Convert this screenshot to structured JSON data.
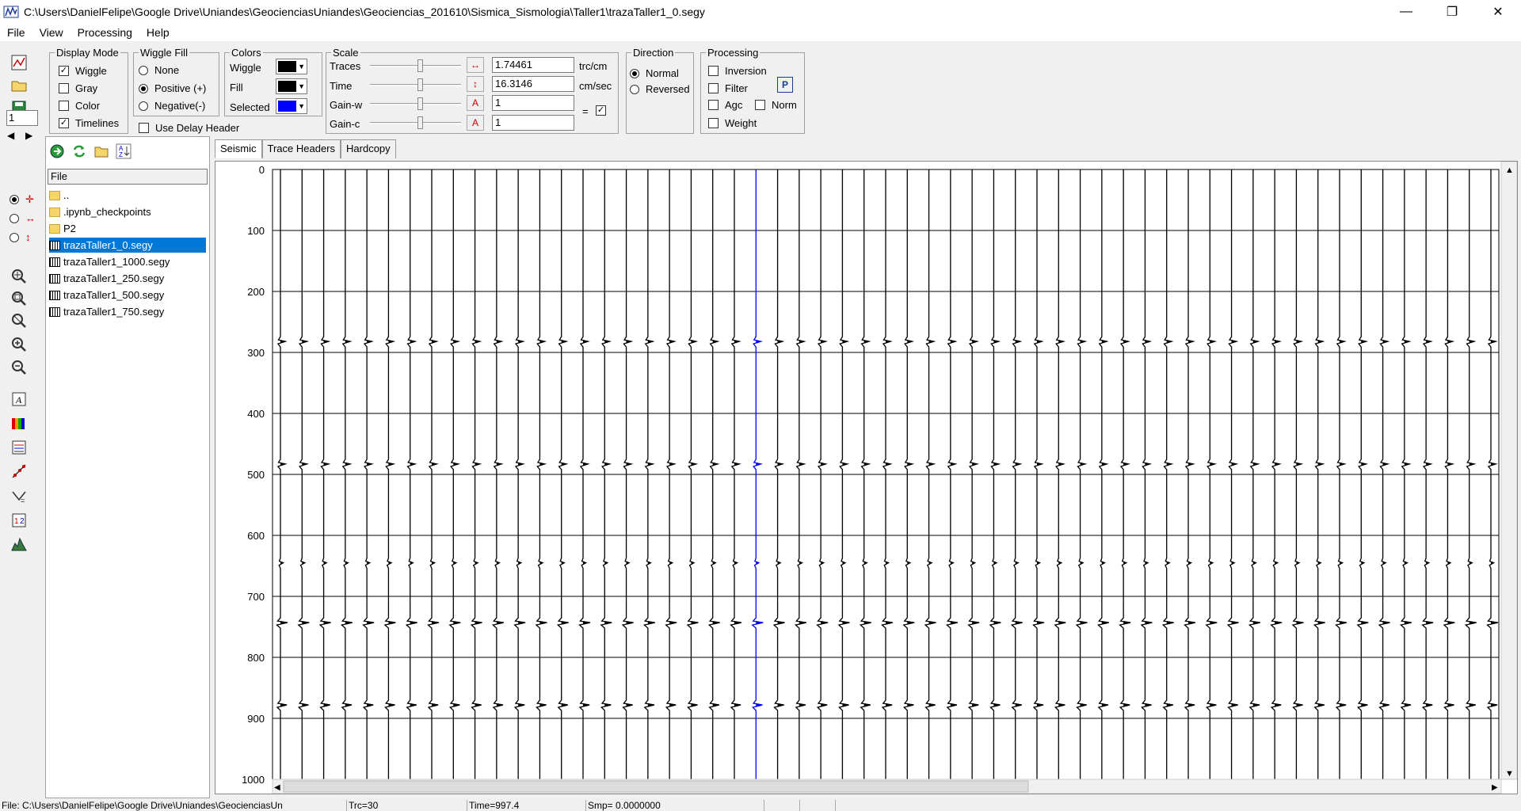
{
  "window": {
    "title": "C:\\Users\\DanielFelipe\\Google Drive\\Uniandes\\GeocienciasUniandes\\Geociencias_201610\\Sismica_Sismologia\\Taller1\\trazaTaller1_0.segy",
    "minimize": "—",
    "maximize": "❐",
    "close": "✕"
  },
  "menu": [
    "File",
    "View",
    "Processing",
    "Help"
  ],
  "display_mode": {
    "legend": "Display Mode",
    "wiggle": "Wiggle",
    "gray": "Gray",
    "color": "Color",
    "timelines": "Timelines",
    "wiggle_checked": true,
    "gray_checked": false,
    "color_checked": false,
    "timelines_checked": true
  },
  "wiggle_fill": {
    "legend": "Wiggle Fill",
    "none": "None",
    "positive": "Positive (+)",
    "negative": "Negative(-)",
    "selected": "positive"
  },
  "use_delay_header": {
    "label": "Use Delay  Header",
    "checked": false
  },
  "colors": {
    "legend": "Colors",
    "wiggle_label": "Wiggle",
    "fill_label": "Fill",
    "selected_label": "Selected",
    "wiggle_color": "#000000",
    "fill_color": "#000000",
    "selected_color": "#0000ff"
  },
  "scale": {
    "legend": "Scale",
    "traces_label": "Traces",
    "time_label": "Time",
    "gainw_label": "Gain-w",
    "gainc_label": "Gain-c",
    "traces_value": "1.74461",
    "time_value": "16.3146",
    "gainw_value": "1",
    "gainc_value": "1",
    "traces_unit": "trc/cm",
    "time_unit": "cm/sec",
    "equals": "=",
    "link_checked": true
  },
  "direction": {
    "legend": "Direction",
    "normal": "Normal",
    "reversed": "Reversed",
    "selected": "normal"
  },
  "processing": {
    "legend": "Processing",
    "inversion": "Inversion",
    "filter": "Filter",
    "agc": "Agc",
    "norm": "Norm",
    "weight": "Weight",
    "p_button": "P"
  },
  "trace_spin": "1",
  "file_panel": {
    "header": "File",
    "items": [
      {
        "name": "..",
        "type": "folder"
      },
      {
        "name": ".ipynb_checkpoints",
        "type": "folder"
      },
      {
        "name": "P2",
        "type": "folder"
      },
      {
        "name": "trazaTaller1_0.segy",
        "type": "segy",
        "selected": true
      },
      {
        "name": "trazaTaller1_1000.segy",
        "type": "segy"
      },
      {
        "name": "trazaTaller1_250.segy",
        "type": "segy"
      },
      {
        "name": "trazaTaller1_500.segy",
        "type": "segy"
      },
      {
        "name": "trazaTaller1_750.segy",
        "type": "segy"
      }
    ]
  },
  "tabs": [
    "Seismic",
    "Trace Headers",
    "Hardcopy"
  ],
  "chart_data": {
    "type": "wiggle",
    "y_ticks": [
      "0",
      "100",
      "200",
      "300",
      "400",
      "500",
      "600",
      "700",
      "800",
      "900",
      "1000"
    ],
    "ylim": [
      0,
      1000
    ],
    "trace_count": 57,
    "selected_trace": 22,
    "event_times": [
      282,
      483,
      645,
      743,
      878
    ],
    "event_strength": [
      0.7,
      0.7,
      0.4,
      1.0,
      0.9
    ],
    "timelines_every": 100,
    "wiggle_color": "#000000",
    "selected_color": "#0000ff"
  },
  "status": {
    "file": "File: C:\\Users\\DanielFelipe\\Google Drive\\Uniandes\\GeocienciasUn",
    "trc": "Trc=30",
    "time": "Time=997.4",
    "smp": "Smp= 0.0000000"
  }
}
